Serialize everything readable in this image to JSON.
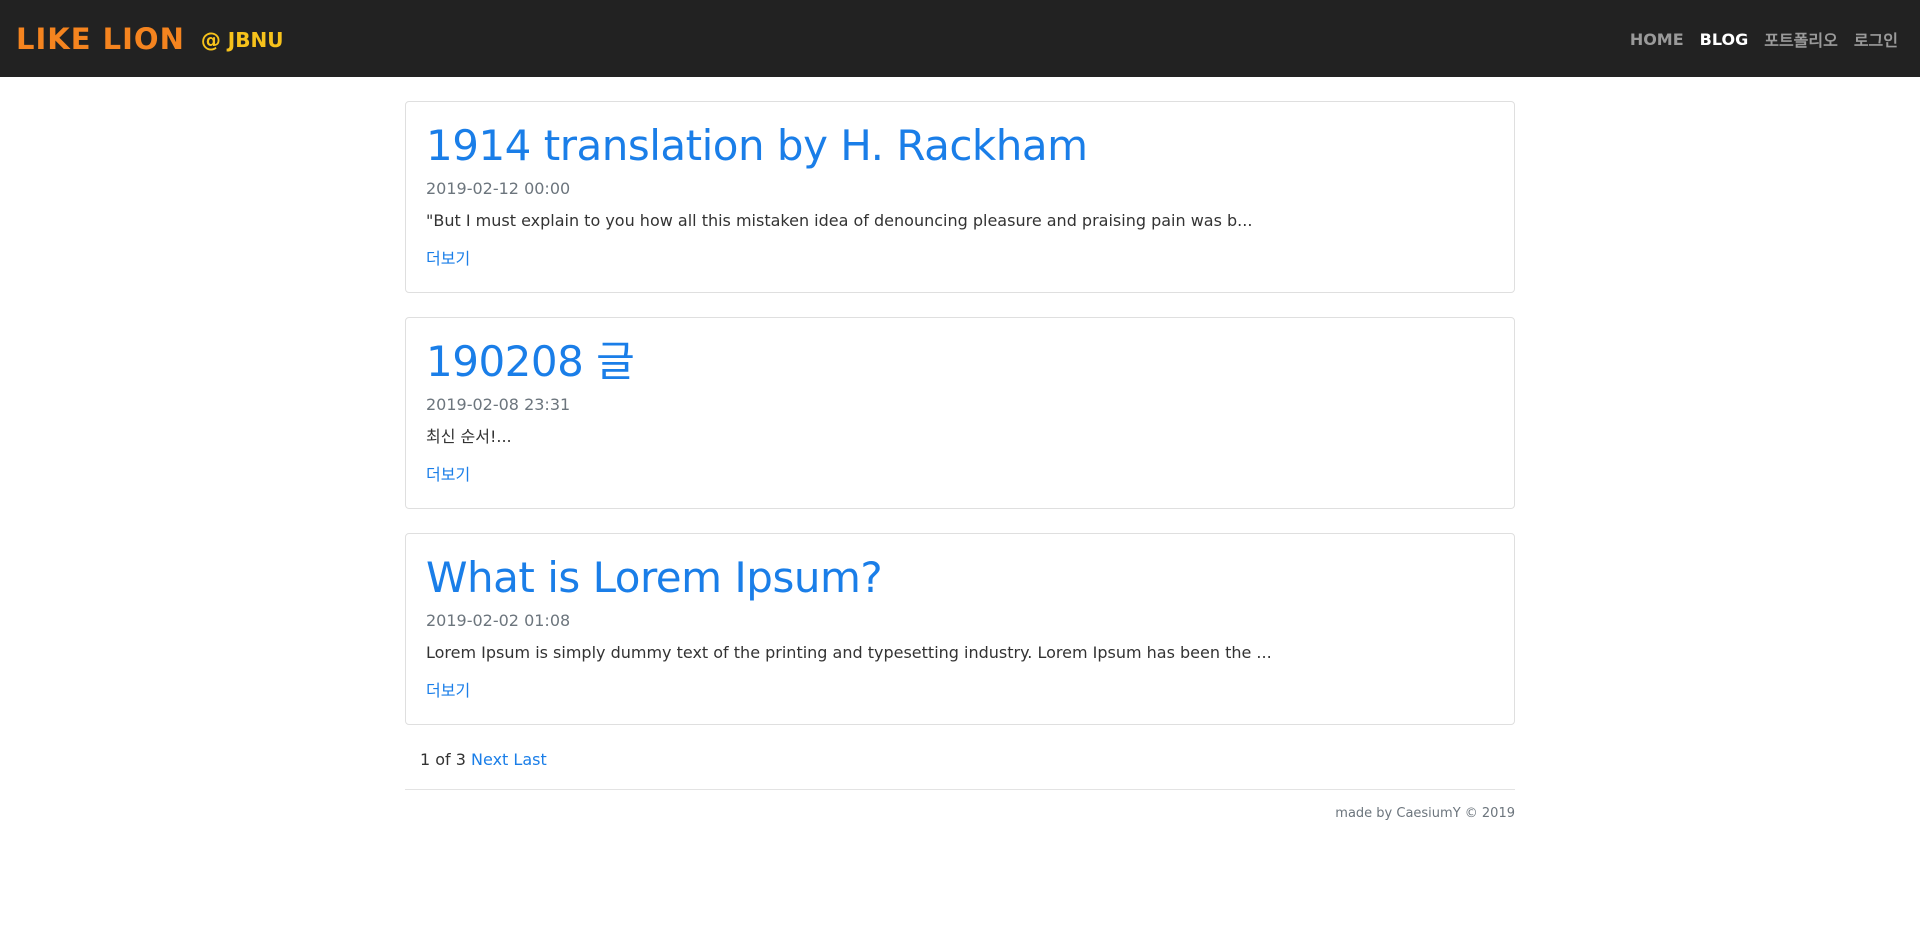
{
  "navbar": {
    "brand": "LIKE LION",
    "brand_sub": "@ JBNU",
    "links": [
      {
        "label": "HOME",
        "active": false
      },
      {
        "label": "BLOG",
        "active": true
      },
      {
        "label": "포트폴리오",
        "active": false
      },
      {
        "label": "로그인",
        "active": false
      }
    ]
  },
  "posts": [
    {
      "title": "1914 translation by H. Rackham",
      "date": "2019-02-12 00:00",
      "excerpt": "\"But I must explain to you how all this mistaken idea of denouncing pleasure and praising pain was b...",
      "more": "더보기"
    },
    {
      "title": "190208 글",
      "date": "2019-02-08 23:31",
      "excerpt": "최신 순서!...",
      "more": "더보기"
    },
    {
      "title": "What is Lorem Ipsum?",
      "date": "2019-02-02 01:08",
      "excerpt": "Lorem Ipsum is simply dummy text of the printing and typesetting industry. Lorem Ipsum has been the ...",
      "more": "더보기"
    }
  ],
  "pagination": {
    "status": "1 of 3",
    "next": "Next",
    "last": "Last"
  },
  "footer": {
    "text": "made by CaesiumY © 2019"
  },
  "colors": {
    "navbar_bg": "#222222",
    "brand": "#f5841f",
    "brand_sub": "#f7c21b",
    "link": "#1a7ee8",
    "muted": "#6c757d"
  }
}
